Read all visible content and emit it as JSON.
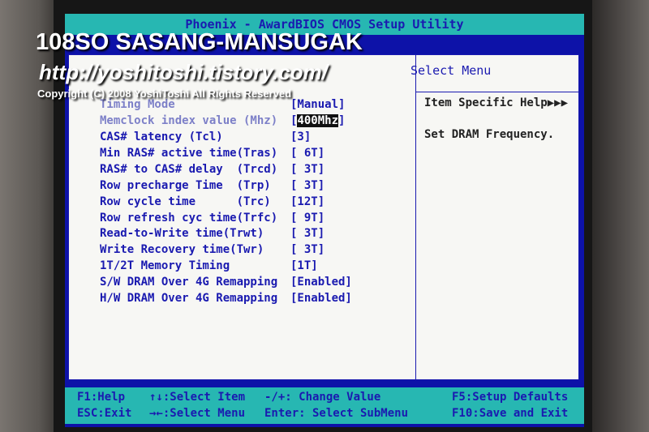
{
  "bios": {
    "title": "Phoenix - AwardBIOS CMOS Setup Utility",
    "side_header": "Select Menu",
    "help_title": "Item Specific Help▶▶▶",
    "help_text": "Set DRAM Frequency."
  },
  "settings": [
    {
      "label": "Timing Mode",
      "value": "[Manual]"
    },
    {
      "label": "Memclock index value (Mhz)",
      "value_open": "[",
      "value_sel": "400Mhz",
      "value_close": "]"
    },
    {
      "label": "CAS# latency (Tcl)",
      "value": "[3]"
    },
    {
      "label": "Min RAS# active time(Tras)",
      "value": "[ 6T]"
    },
    {
      "label": "RAS# to CAS# delay  (Trcd)",
      "value": "[ 3T]"
    },
    {
      "label": "Row precharge Time  (Trp)",
      "value": "[ 3T]"
    },
    {
      "label": "Row cycle time      (Trc)",
      "value": "[12T]"
    },
    {
      "label": "Row refresh cyc time(Trfc)",
      "value": "[ 9T]"
    },
    {
      "label": "Read-to-Write time(Trwt)",
      "value": "[ 3T]"
    },
    {
      "label": "Write Recovery time(Twr)",
      "value": "[ 3T]"
    },
    {
      "label": "1T/2T Memory Timing",
      "value": "[1T]"
    },
    {
      "label": "S/W DRAM Over 4G Remapping",
      "value": "[Enabled]"
    },
    {
      "label": "H/W DRAM Over 4G Remapping",
      "value": "[Enabled]"
    }
  ],
  "footer": {
    "help": "F1:Help",
    "exit": "ESC:Exit",
    "select_item": "↑↓:Select Item",
    "select_menu": "→←:Select Menu",
    "change_value": "-/+: Change Value",
    "select_submenu": "Enter: Select SubMenu",
    "setup_defaults": "F5:Setup Defaults",
    "save_exit": "F10:Save and Exit"
  },
  "watermark": {
    "line1": "108SO SASANG-MANSUGAK",
    "line2": "http://yoshitoshi.tistory.com/",
    "line3": "Copyright (C) 2008 YoshiToshi All Rights Reserved"
  }
}
